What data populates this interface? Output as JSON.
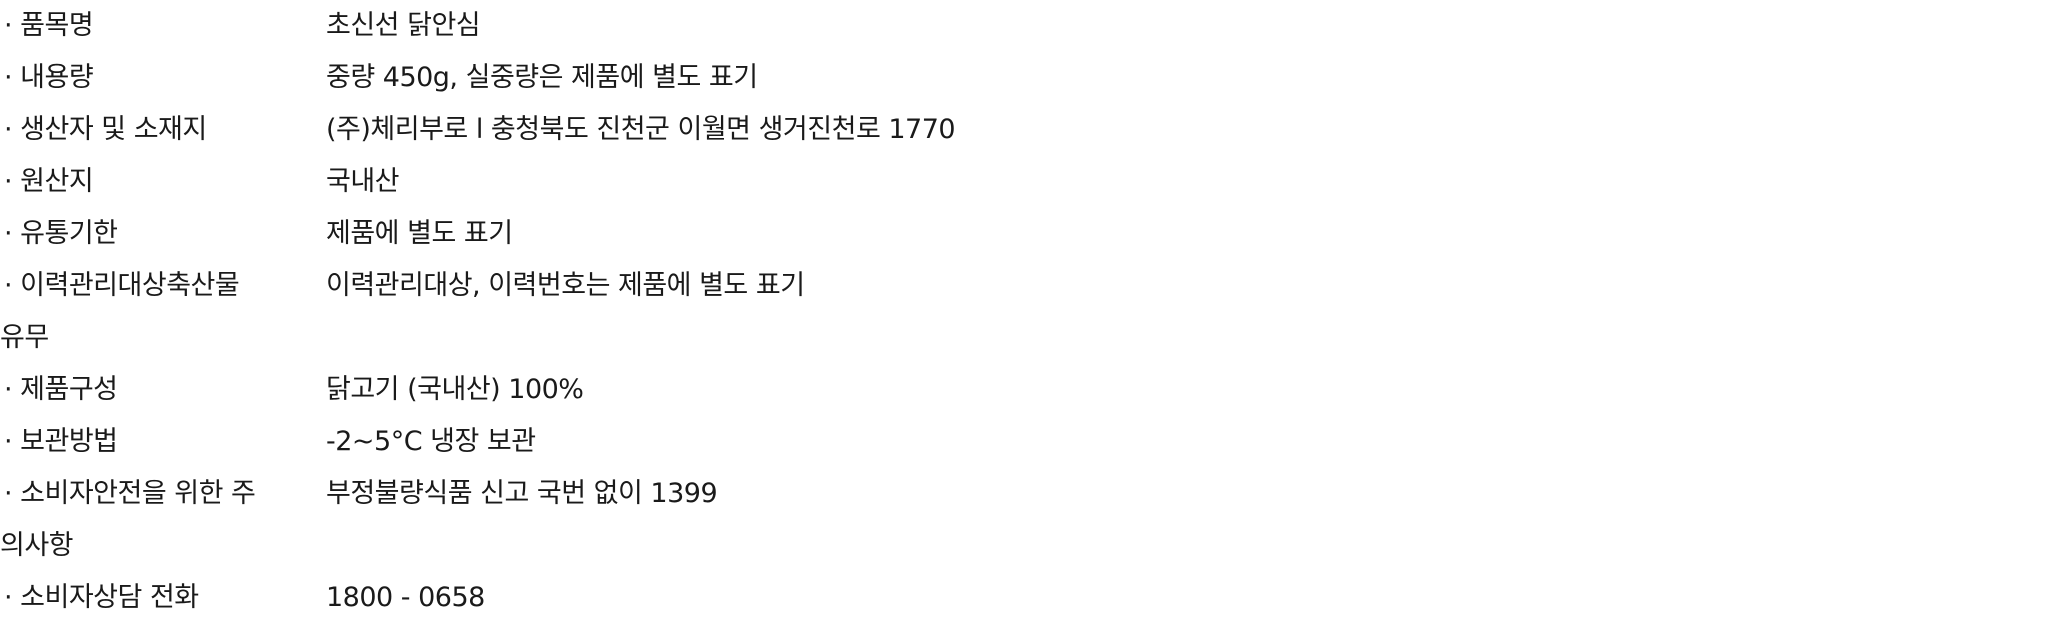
{
  "rows": [
    {
      "label": "· 품목명",
      "value": "초신선 닭안심"
    },
    {
      "label": "· 내용량",
      "value": "중량 450g, 실중량은 제품에 별도 표기"
    },
    {
      "label": "· 생산자 및 소재지",
      "value": "(주)체리부로 l 충청북도 진천군 이월면 생거진천로 1770"
    },
    {
      "label": "· 원산지",
      "value": "국내산"
    },
    {
      "label": "· 유통기한",
      "value": "제품에 별도 표기"
    },
    {
      "label": "· 이력관리대상축산물",
      "label_cont": "유무",
      "value": "이력관리대상, 이력번호는 제품에 별도 표기"
    },
    {
      "label": "· 제품구성",
      "value": "닭고기 (국내산) 100%"
    },
    {
      "label": "· 보관방법",
      "value": "-2~5°C 냉장 보관"
    },
    {
      "label": "· 소비자안전을 위한 주",
      "label_cont": "의사항",
      "value": "부정불량식품 신고 국번 없이 1399"
    },
    {
      "label": "· 소비자상담 전화",
      "value": "1800 - 0658"
    }
  ]
}
